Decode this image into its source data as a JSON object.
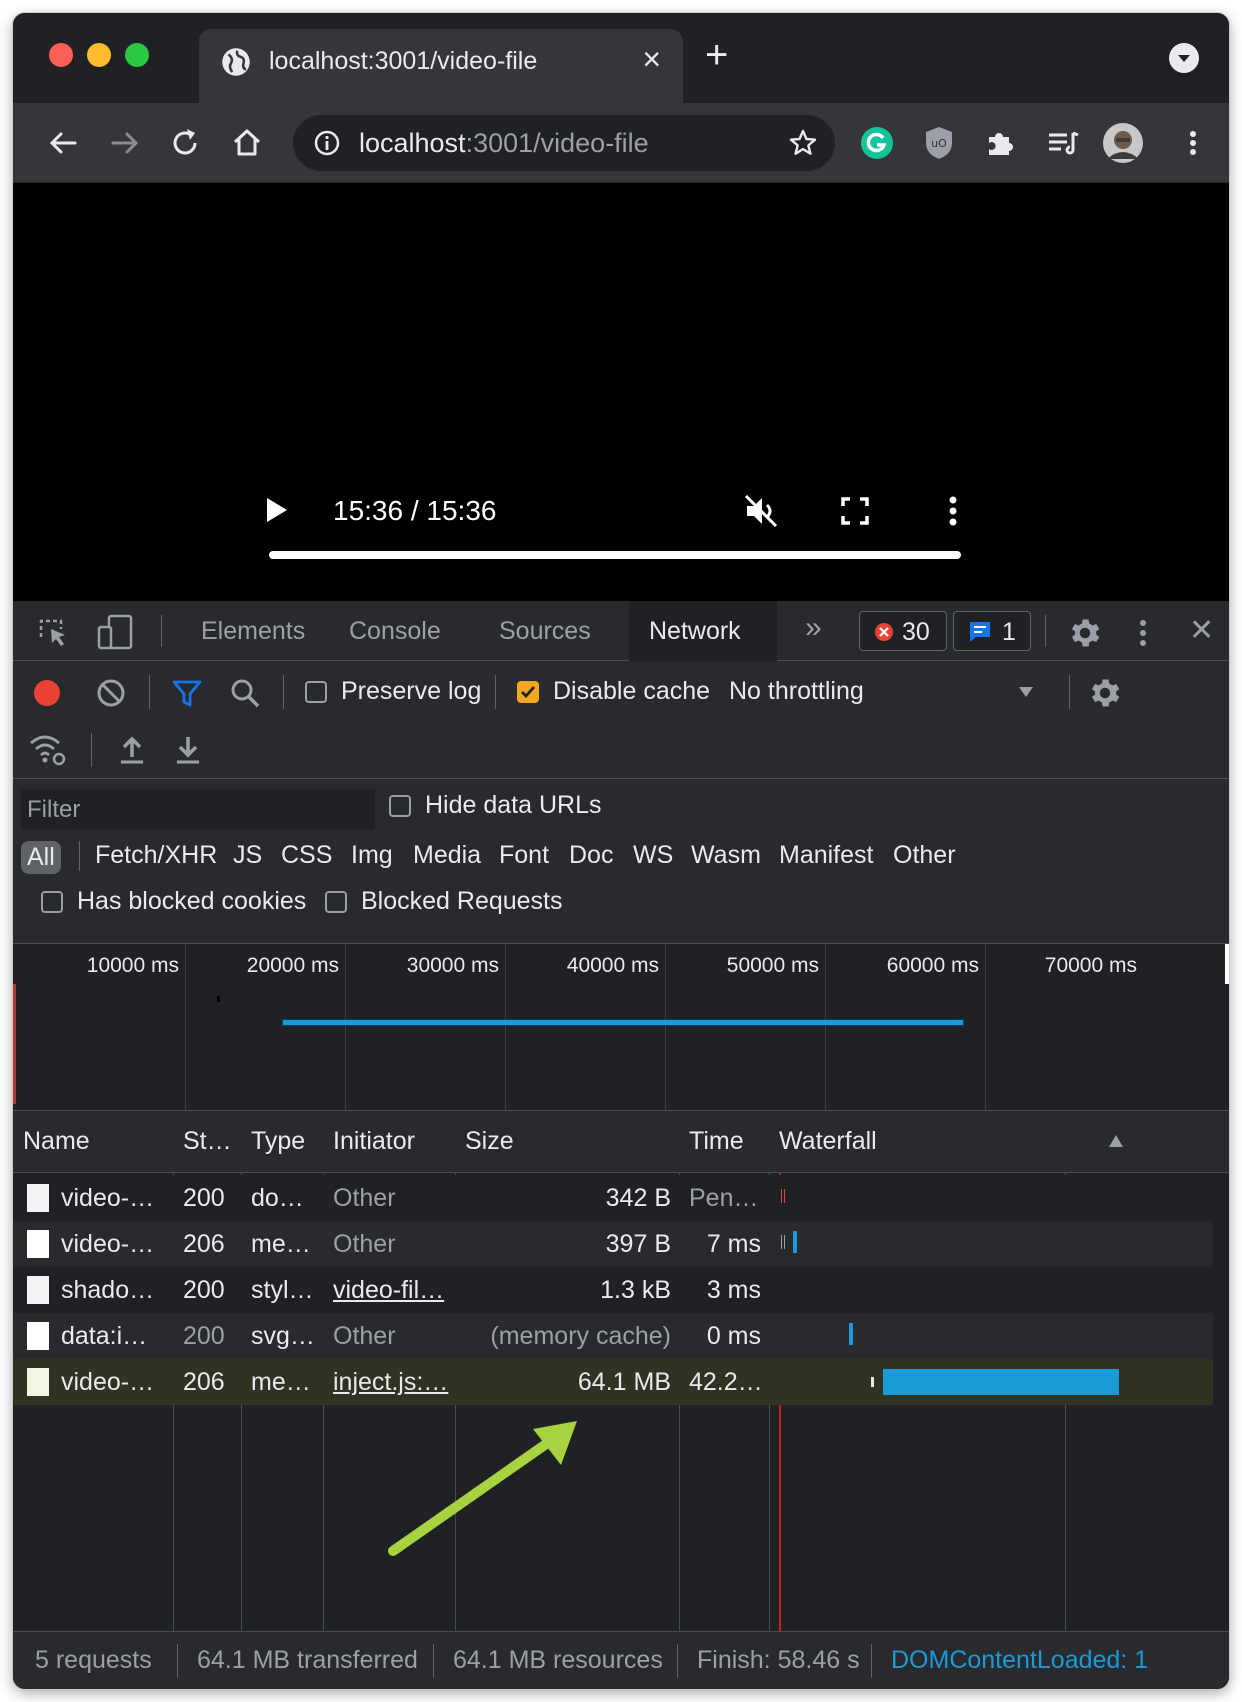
{
  "browser": {
    "tab_title": "localhost:3001/video-file",
    "tab_close": "×",
    "new_tab": "+",
    "url_host": "localhost",
    "url_rest": ":3001/video-file"
  },
  "video": {
    "time": "15:36 / 15:36",
    "progress_fraction": 1.0
  },
  "devtools": {
    "tabs": [
      "Elements",
      "Console",
      "Sources",
      "Network"
    ],
    "more_tabs": "»",
    "errors_count": "30",
    "messages_count": "1",
    "close": "✕",
    "toolbar": {
      "preserve_log": "Preserve log",
      "disable_cache": "Disable cache",
      "throttling": "No throttling"
    },
    "filter": {
      "placeholder": "Filter",
      "hide_data_urls": "Hide data URLs",
      "types": [
        "All",
        "Fetch/XHR",
        "JS",
        "CSS",
        "Img",
        "Media",
        "Font",
        "Doc",
        "WS",
        "Wasm",
        "Manifest",
        "Other"
      ],
      "has_blocked_cookies": "Has blocked cookies",
      "blocked_requests": "Blocked Requests"
    },
    "overview_ticks": [
      "10000 ms",
      "20000 ms",
      "30000 ms",
      "40000 ms",
      "50000 ms",
      "60000 ms",
      "70000 ms"
    ],
    "columns": [
      "Name",
      "St…",
      "Type",
      "Initiator",
      "Size",
      "Time",
      "Waterfall"
    ],
    "rows": [
      {
        "name": "video-…",
        "status": "200",
        "type": "do…",
        "initiator": "Other",
        "size": "342 B",
        "time": "Pen…"
      },
      {
        "name": "video-…",
        "status": "206",
        "type": "me…",
        "initiator": "Other",
        "size": "397 B",
        "time": "7 ms"
      },
      {
        "name": "shado…",
        "status": "200",
        "type": "styl…",
        "initiator": "video-fil…",
        "size": "1.3 kB",
        "time": "3 ms"
      },
      {
        "name": "data:i…",
        "status": "200",
        "type": "svg…",
        "initiator": "Other",
        "size": "(memory cache)",
        "time": "0 ms"
      },
      {
        "name": "video-…",
        "status": "206",
        "type": "me…",
        "initiator": "inject.js:…",
        "size": "64.1 MB",
        "time": "42.2…"
      }
    ],
    "status_bar": {
      "requests": "5 requests",
      "transferred": "64.1 MB transferred",
      "resources": "64.1 MB resources",
      "finish": "Finish: 58.46 s",
      "dom_content_loaded": "DOMContentLoaded: 1"
    }
  },
  "colors": {
    "accent_blue": "#1a9bd7",
    "record_red": "#ea4335",
    "arrow_green": "#a6d33f",
    "checkbox_orange": "#f5a623"
  }
}
